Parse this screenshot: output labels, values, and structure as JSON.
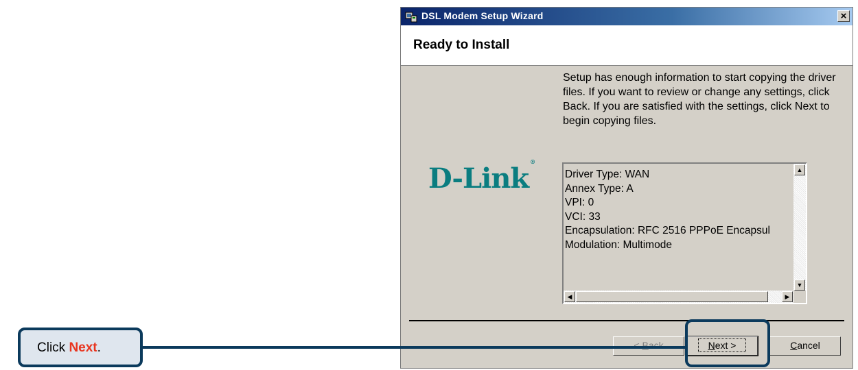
{
  "window": {
    "title": "DSL Modem Setup Wizard",
    "close_glyph": "×",
    "app_icon": "setup-wizard-icon"
  },
  "header": {
    "title": "Ready to Install"
  },
  "logo": {
    "text": "D-Link",
    "trademark": "®",
    "color": "#0a7d80"
  },
  "description": "Setup has enough information to start copying the driver files.  If you want to review or change any settings, click Back.  If you are satisfied with the settings, click Next to begin copying files.",
  "summary": {
    "lines": [
      "Driver Type: WAN",
      "Annex Type: A",
      "VPI: 0",
      "VCI: 33",
      "Encapsulation: RFC 2516 PPPoE Encapsul",
      "Modulation: Multimode"
    ]
  },
  "buttons": {
    "back": {
      "accel": "B",
      "rest": "ack",
      "prefix": "< "
    },
    "next": {
      "accel": "N",
      "rest": "ext >"
    },
    "cancel": {
      "accel": "C",
      "rest": "ancel"
    }
  },
  "annotation": {
    "prefix": "Click ",
    "highlight": "Next",
    "suffix": ".",
    "colors": {
      "border": "#0b3a5c",
      "fill": "#dfe6ee",
      "highlight": "#e8351f"
    }
  }
}
